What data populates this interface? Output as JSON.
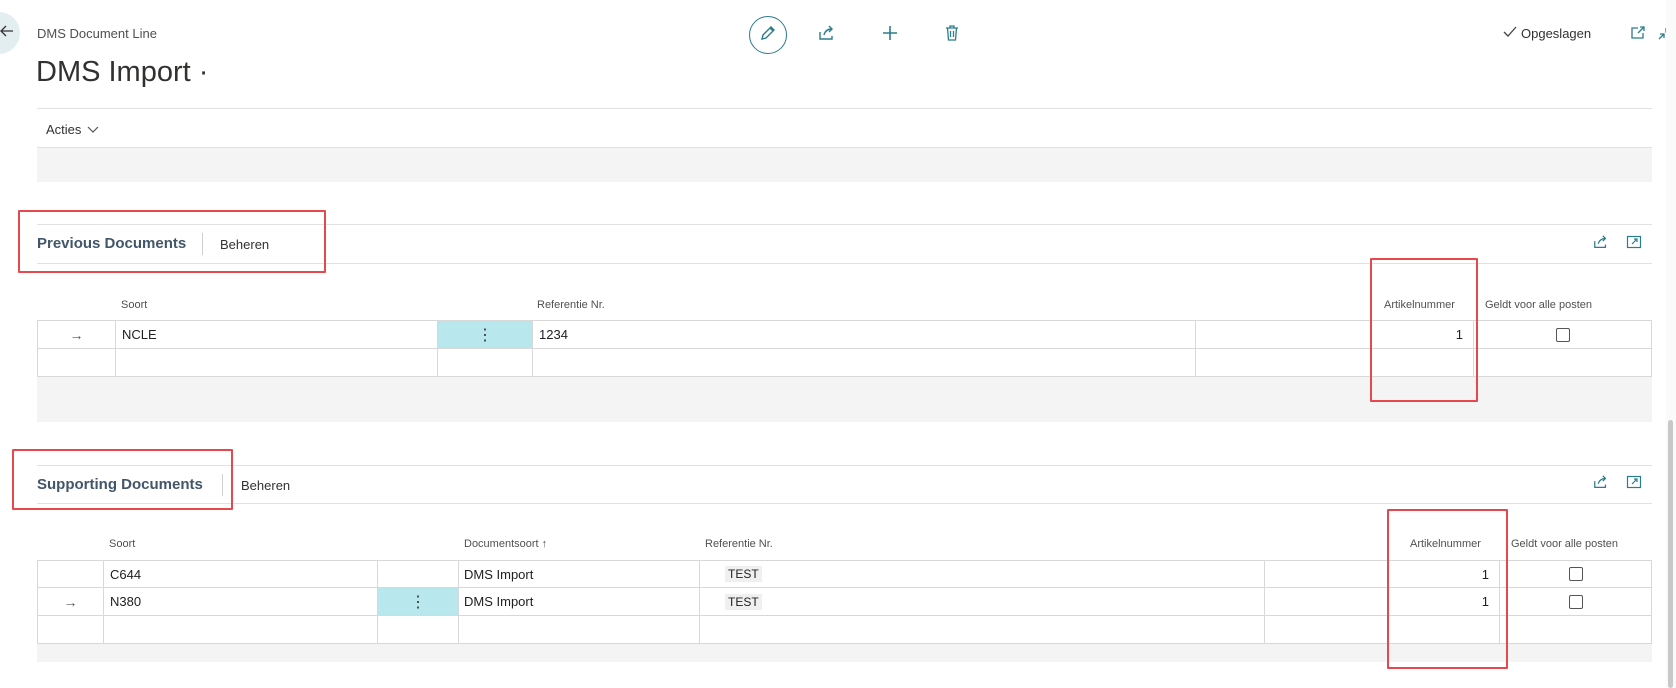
{
  "header": {
    "breadcrumb": "DMS Document Line",
    "title": "DMS Import ·",
    "saved_label": "Opgeslagen",
    "actions_label": "Acties"
  },
  "previous": {
    "title": "Previous Documents",
    "manage_label": "Beheren",
    "columns": {
      "soort": "Soort",
      "referentie": "Referentie Nr.",
      "artikel": "Artikelnummer",
      "geldt": "Geldt voor alle posten"
    },
    "rows": [
      {
        "soort": "NCLE",
        "referentie": "1234",
        "artikel": "1"
      }
    ]
  },
  "supporting": {
    "title": "Supporting Documents",
    "manage_label": "Beheren",
    "columns": {
      "soort": "Soort",
      "documentsoort": "Documentsoort",
      "referentie": "Referentie Nr.",
      "artikel": "Artikelnummer",
      "geldt": "Geldt voor alle posten"
    },
    "rows": [
      {
        "soort": "C644",
        "documentsoort": "DMS Import",
        "referentie": "TEST",
        "artikel": "1"
      },
      {
        "soort": "N380",
        "documentsoort": "DMS Import",
        "referentie": "TEST",
        "artikel": "1"
      }
    ]
  },
  "icons": {
    "back": "back-arrow-icon",
    "edit": "pencil-icon",
    "share": "share-icon",
    "add": "plus-icon",
    "delete": "trash-icon",
    "saved": "checkmark-icon",
    "open_new": "open-new-window-icon",
    "collapse": "collapse-icon",
    "sort": "sort-ascending-icon"
  },
  "colors": {
    "accent": "#2b7d8b",
    "highlight_box": "#e5484d",
    "selected_cell": "#b8e8ee"
  }
}
